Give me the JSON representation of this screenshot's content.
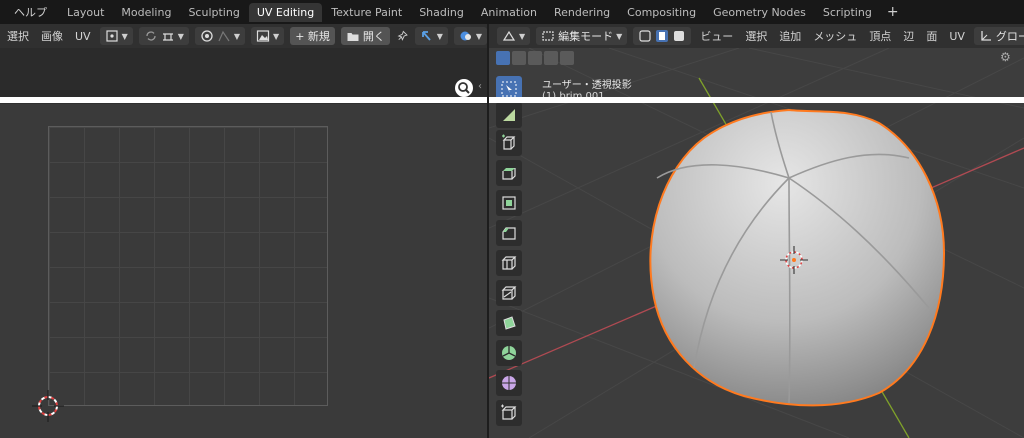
{
  "topbar": {
    "help": "ヘルプ",
    "tabs": [
      "Layout",
      "Modeling",
      "Sculpting",
      "UV Editing",
      "Texture Paint",
      "Shading",
      "Animation",
      "Rendering",
      "Compositing",
      "Geometry Nodes",
      "Scripting"
    ],
    "active_tab": "UV Editing",
    "add": "+"
  },
  "uv_header": {
    "menus": [
      "選択",
      "画像",
      "UV"
    ],
    "new_label": "+ 新規",
    "open_label": "開く"
  },
  "viewport_header": {
    "mode_label": "編集モード",
    "menus": [
      "ビュー",
      "選択",
      "追加",
      "メッシュ",
      "頂点",
      "辺",
      "面",
      "UV"
    ],
    "orientation_label": "グローバル"
  },
  "viewport": {
    "overlay_title": "ユーザー・透視投影",
    "overlay_sub": "(1) brim.001"
  },
  "colors": {
    "accent": "#4772b3",
    "selection_outline": "#ff7a1f",
    "x_axis": "#b04a52",
    "y_axis": "#7fa12a"
  },
  "icons": [
    "pin-icon",
    "zoom-icon",
    "select-box-icon",
    "cursor-icon",
    "transform-icon",
    "add-cube-icon",
    "extrude-icon",
    "inset-icon",
    "bevel-icon",
    "loop-cut-icon",
    "knife-icon",
    "poly-build-icon",
    "spin-icon",
    "smooth-icon",
    "shear-icon",
    "3d-cursor-icon"
  ]
}
